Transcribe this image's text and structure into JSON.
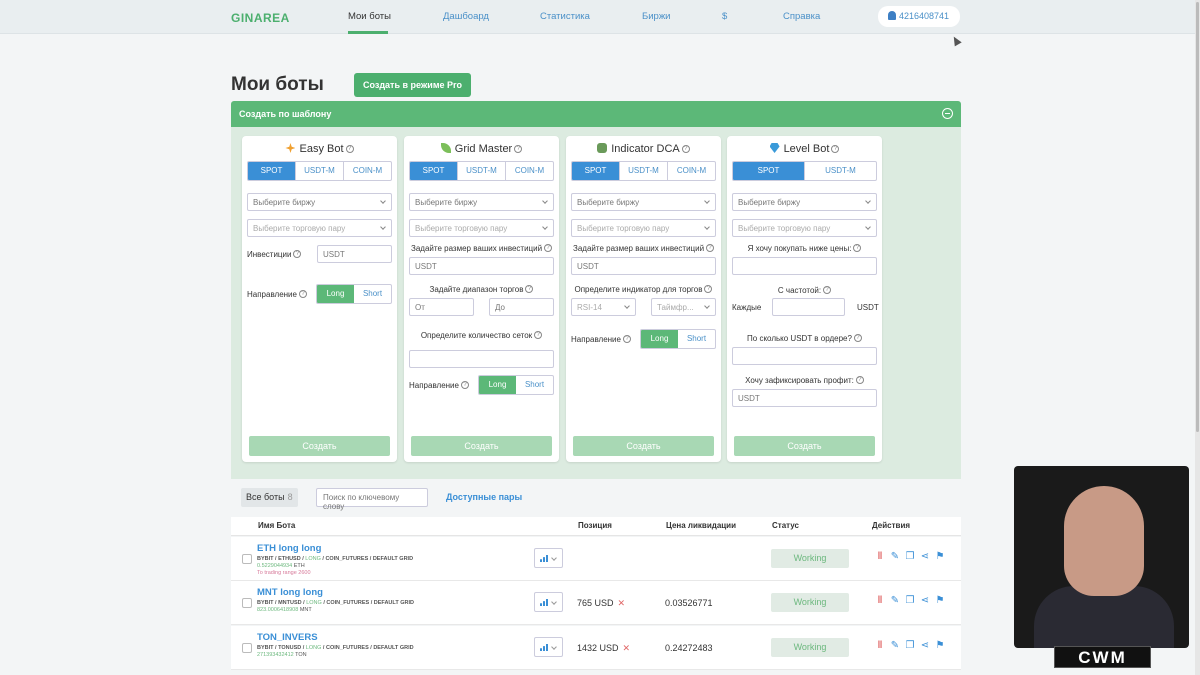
{
  "nav": {
    "logo": "GINAREA",
    "items": [
      "Мои боты",
      "Дашбоард",
      "Статистика",
      "Биржи",
      "$",
      "Справка"
    ],
    "user_id": "4216408741"
  },
  "page": {
    "title": "Мои боты",
    "pro_button": "Создать в режиме Pro",
    "template_bar": "Создать по шаблону"
  },
  "cards": [
    {
      "title": "Easy Bot",
      "icon": "sparkle-icon",
      "tabs": [
        "SPOT",
        "USDT-M",
        "COIN-M"
      ],
      "exchange": "Выберите биржу",
      "pair": "Выберите торговую пару",
      "invest_label": "Инвестиции",
      "invest_placeholder": "USDT",
      "direction_label": "Направление",
      "long": "Long",
      "short": "Short",
      "create": "Создать"
    },
    {
      "title": "Grid Master",
      "icon": "leaf-icon",
      "tabs": [
        "SPOT",
        "USDT-M",
        "COIN-M"
      ],
      "exchange": "Выберите биржу",
      "pair": "Выберите торговую пару",
      "invest_label": "Задайте размер ваших инвестиций",
      "invest_placeholder": "USDT",
      "range_label": "Задайте диапазон торгов",
      "from": "От",
      "to": "До",
      "grids_label": "Определите количество сеток",
      "direction_label": "Направление",
      "long": "Long",
      "short": "Short",
      "create": "Создать"
    },
    {
      "title": "Indicator DCA",
      "icon": "dca-icon",
      "tabs": [
        "SPOT",
        "USDT-M",
        "COIN-M"
      ],
      "exchange": "Выберите биржу",
      "pair": "Выберите торговую пару",
      "invest_label": "Задайте размер ваших инвестиций",
      "invest_placeholder": "USDT",
      "indicator_label": "Определите индикатор для торгов",
      "indicator": "RSI-14",
      "timeframe": "Таймфр...",
      "direction_label": "Направление",
      "long": "Long",
      "short": "Short",
      "create": "Создать"
    },
    {
      "title": "Level Bot",
      "icon": "diamond-icon",
      "tabs": [
        "SPOT",
        "USDT-M"
      ],
      "exchange": "Выберите биржу",
      "pair": "Выберите торговую пару",
      "buy_below_label": "Я хочу покупать ниже цены:",
      "freq_label": "С частотой:",
      "every": "Каждые",
      "usdt": "USDT",
      "per_order_label": "По сколько USDT в ордере?",
      "profit_label": "Хочу зафиксировать профит:",
      "profit_placeholder": "USDT",
      "create": "Создать"
    }
  ],
  "filter": {
    "all_bots": "Все боты",
    "count": "8",
    "search_placeholder": "Поиск по ключевому слову",
    "pairs": "Доступные пары"
  },
  "table": {
    "headers": [
      "Имя Бота",
      "Позиция",
      "Цена ликвидации",
      "Статус",
      "Действия"
    ],
    "rows": [
      {
        "name": "ETH long long",
        "meta_pre": "BYBIT / ETHUSD / ",
        "dir": "LONG",
        "meta_post": " / COIN_FUTURES / DEFAULT GRID",
        "amount": "0.5229044934",
        "unit": " ETH",
        "range": "To trading range 2600",
        "position": "",
        "liq": "",
        "status": "Working"
      },
      {
        "name": "MNT long long",
        "meta_pre": "BYBIT / MNTUSD / ",
        "dir": "LONG",
        "meta_post": " / COIN_FUTURES / DEFAULT GRID",
        "amount": "823.0006418908",
        "unit": " MNT",
        "range": "",
        "position": "765 USD",
        "liq": "0.03526771",
        "status": "Working"
      },
      {
        "name": "TON_INVERS",
        "meta_pre": "BYBIT / TONUSD / ",
        "dir": "LONG",
        "meta_post": " / COIN_FUTURES / DEFAULT GRID",
        "amount": "271393432412",
        "unit": " TON",
        "range": "",
        "position": "1432 USD",
        "liq": "0.24272483",
        "status": "Working"
      }
    ]
  },
  "overlay": {
    "logo": "CWM"
  },
  "colors": {
    "green": "#5cb878",
    "blue": "#3a8fd6"
  }
}
